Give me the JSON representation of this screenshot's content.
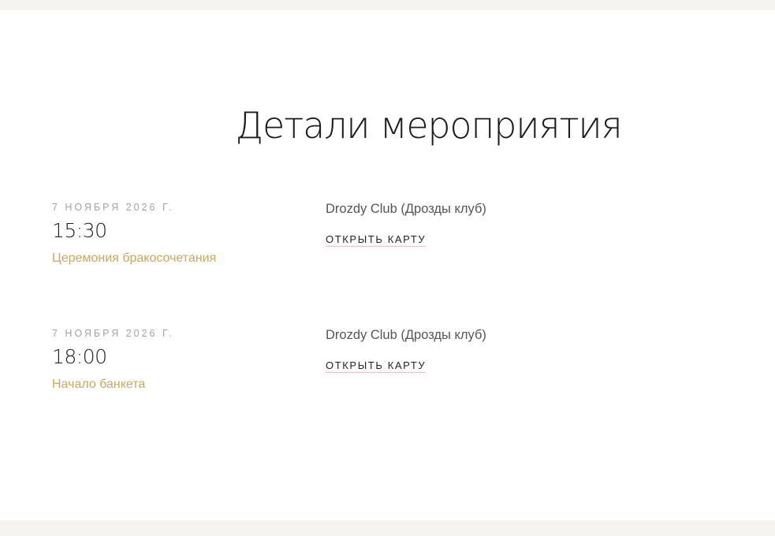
{
  "page": {
    "title": "Детали мероприятия"
  },
  "events": [
    {
      "date": "7 НОЯБРЯ 2026 Г.",
      "time": "15:30",
      "name": "Церемония бракосочетания",
      "venue": "Drozdy Club (Дрозды клуб)",
      "map_link": "ОТКРЫТЬ КАРТУ"
    },
    {
      "date": "7 НОЯБРЯ 2026 Г.",
      "time": "18:00",
      "name": "Начало банкета",
      "venue": "Drozdy Club (Дрозды клуб)",
      "map_link": "ОТКРЫТЬ КАРТУ"
    }
  ],
  "colors": {
    "accent": "#cda855",
    "background": "#ffffff",
    "page_band": "#f5f4f1",
    "heading": "#1c1c1c",
    "muted": "#a3a3a3",
    "link_underline": "#ecc0c0"
  }
}
